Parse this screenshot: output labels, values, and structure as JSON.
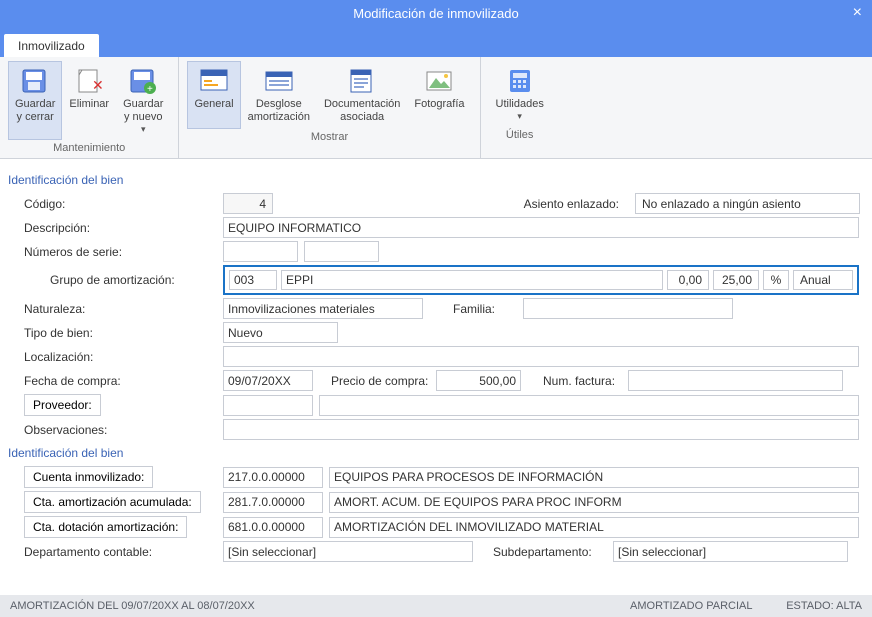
{
  "window": {
    "title": "Modificación de inmovilizado"
  },
  "tab": {
    "label": "Inmovilizado"
  },
  "ribbon": {
    "groups": {
      "mant": {
        "title": "Mantenimiento",
        "guardar_cerrar": "Guardar\ny cerrar",
        "eliminar": "Eliminar",
        "guardar_nuevo": "Guardar\ny nuevo"
      },
      "mostrar": {
        "title": "Mostrar",
        "general": "General",
        "desglose": "Desglose\namortización",
        "doc": "Documentación\nasociada",
        "foto": "Fotografía"
      },
      "utiles": {
        "title": "Útiles",
        "utilidades": "Utilidades"
      }
    }
  },
  "form": {
    "section1_title": "Identificación del bien",
    "codigo_label": "Código:",
    "codigo_value": "4",
    "asiento_label": "Asiento enlazado:",
    "asiento_value": "No enlazado a ningún asiento",
    "descripcion_label": "Descripción:",
    "descripcion_value": "EQUIPO INFORMATICO",
    "numserie_label": "Números de serie:",
    "numserie_a": "",
    "numserie_b": "",
    "grupo_label": "Grupo de amortización:",
    "grupo_cod": "003",
    "grupo_desc": "EPPI",
    "grupo_v1": "0,00",
    "grupo_v2": "25,00",
    "grupo_unit": "%",
    "grupo_periodo": "Anual",
    "naturaleza_label": "Naturaleza:",
    "naturaleza_value": "Inmovilizaciones materiales",
    "familia_label": "Familia:",
    "familia_value": "",
    "tipobien_label": "Tipo de bien:",
    "tipobien_value": "Nuevo",
    "localizacion_label": "Localización:",
    "localizacion_value": "",
    "fechacompra_label": "Fecha de compra:",
    "fechacompra_value": "09/07/20XX",
    "preciocompra_label": "Precio de compra:",
    "preciocompra_value": "500,00",
    "numfactura_label": "Num. factura:",
    "numfactura_value": "",
    "proveedor_label": "Proveedor:",
    "proveedor_cod": "",
    "proveedor_desc": "",
    "observaciones_label": "Observaciones:",
    "observaciones_value": "",
    "section2_title": "Identificación del bien",
    "ctainmov_label": "Cuenta inmovilizado:",
    "ctainmov_cod": "217.0.0.00000",
    "ctainmov_desc": "EQUIPOS PARA PROCESOS DE INFORMACIÓN",
    "ctaamortac_label": "Cta. amortización acumulada:",
    "ctaamortac_cod": "281.7.0.00000",
    "ctaamortac_desc": "AMORT. ACUM. DE EQUIPOS PARA PROC INFORM",
    "ctadot_label": "Cta. dotación amortización:",
    "ctadot_cod": "681.0.0.00000",
    "ctadot_desc": "AMORTIZACIÓN DEL INMOVILIZADO MATERIAL",
    "dept_label": "Departamento contable:",
    "dept_value": "[Sin seleccionar]",
    "subdept_label": "Subdepartamento:",
    "subdept_value": "[Sin seleccionar]"
  },
  "status": {
    "left1": "AMORTIZACIÓN DEL 09/07/20XX AL 08/07/20XX",
    "right1": "AMORTIZADO PARCIAL",
    "right2": "ESTADO: ALTA"
  }
}
